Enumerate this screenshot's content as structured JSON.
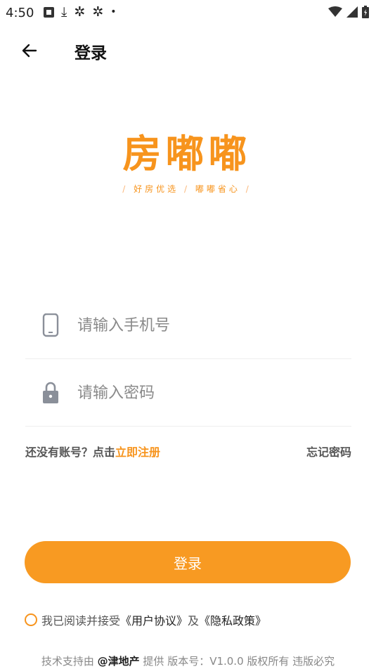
{
  "status_bar": {
    "time": "4:50",
    "left_icons": [
      "notification-icon",
      "download-icon",
      "bug-icon",
      "bug-icon",
      "dot-icon"
    ],
    "right_icons": [
      "wifi-icon",
      "signal-icon",
      "battery-charging-icon"
    ]
  },
  "header": {
    "back_icon": "arrow-left-icon",
    "title": "登录"
  },
  "logo": {
    "brand": "房嘟嘟",
    "slogan_left": "好房优选",
    "slogan_right": "嘟嘟省心",
    "color": "#f7941d"
  },
  "form": {
    "phone": {
      "icon": "phone-icon",
      "placeholder": "请输入手机号",
      "value": ""
    },
    "password": {
      "icon": "lock-icon",
      "placeholder": "请输入密码",
      "value": ""
    }
  },
  "links": {
    "register_prompt": "还没有账号？点击",
    "register_link": "立即注册",
    "forgot_password": "忘记密码"
  },
  "login_button": {
    "label": "登录",
    "color": "#f89a22"
  },
  "agreement": {
    "prefix": "我已阅读并接受",
    "user_agreement": "《用户协议》",
    "conjunction": "及",
    "privacy_policy": "《隐私政策》",
    "checked": false
  },
  "footer": {
    "prefix": "技术支持由",
    "brand": "@津地产",
    "suffix": "提供 版本号：V1.0.0 版权所有 违版必究"
  }
}
